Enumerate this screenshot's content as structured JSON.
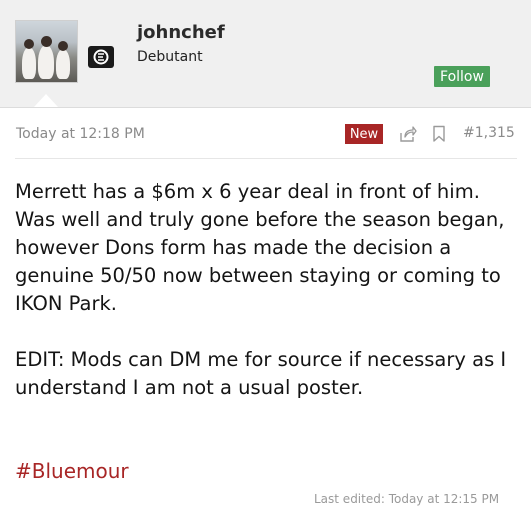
{
  "user": {
    "username": "johnchef",
    "title": "Debutant",
    "follow_label": "Follow"
  },
  "post": {
    "timestamp": "Today at 12:18 PM",
    "badge": "New",
    "number": "#1,315",
    "paragraphs": [
      "Merrett has a $6m x 6 year deal in front of him. Was well and truly gone before the season began, however Dons form has made the decision a genuine 50/50 now between staying or coming to IKON Park.",
      "EDIT: Mods can DM me for source if necessary as I understand I am not a usual poster."
    ],
    "hashtag": "#Bluemour",
    "last_edited": "Last edited: Today at 12:15 PM"
  },
  "icons": {
    "share": "share-icon",
    "bookmark": "bookmark-icon",
    "club_logo": "club-logo-icon"
  },
  "colors": {
    "follow_green": "#4aa05a",
    "badge_red": "#a82626",
    "hashtag_red": "#a82626",
    "panel_bg": "#f0f0f0"
  }
}
